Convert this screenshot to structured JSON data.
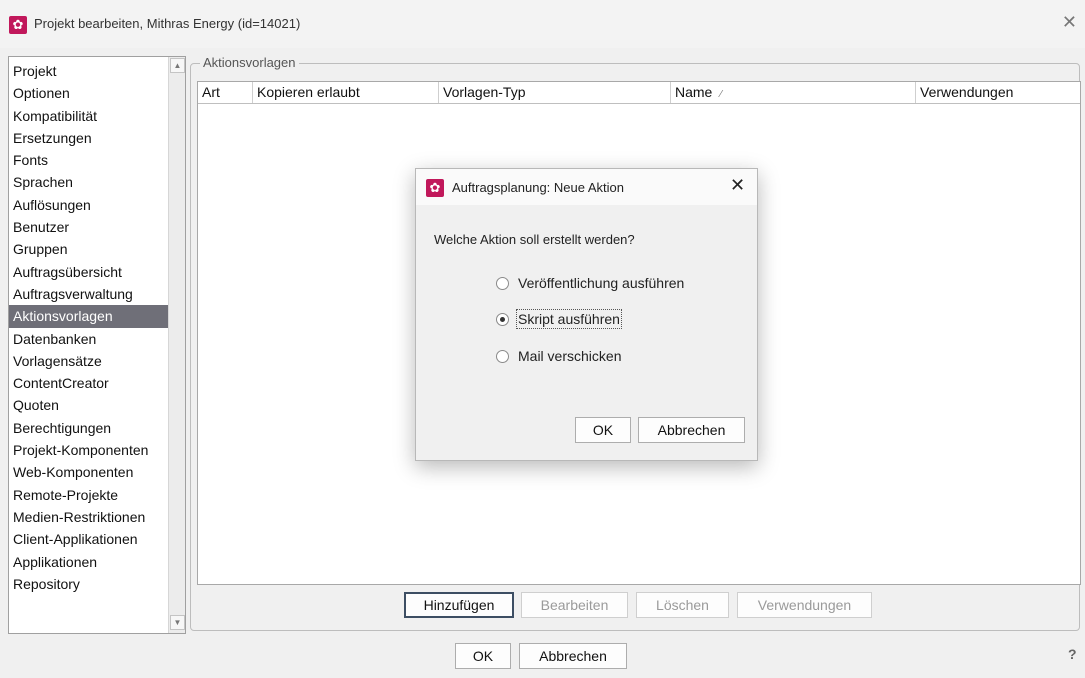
{
  "window": {
    "title": "Projekt bearbeiten, Mithras Energy (id=14021)",
    "app_icon": "gear-logo-icon",
    "accent": "#c1185b"
  },
  "sidebar": {
    "items": [
      "Projekt",
      "Optionen",
      "Kompatibilität",
      "Ersetzungen",
      "Fonts",
      "Sprachen",
      "Auflösungen",
      "Benutzer",
      "Gruppen",
      "Auftragsübersicht",
      "Auftragsverwaltung",
      "Aktionsvorlagen",
      "Datenbanken",
      "Vorlagensätze",
      "ContentCreator",
      "Quoten",
      "Berechtigungen",
      "Projekt-Komponenten",
      "Web-Komponenten",
      "Remote-Projekte",
      "Medien-Restriktionen",
      "Client-Applikationen",
      "Applikationen",
      "Repository"
    ],
    "selected": "Aktionsvorlagen"
  },
  "panel": {
    "legend": "Aktionsvorlagen",
    "columns": [
      "Art",
      "Kopieren erlaubt",
      "Vorlagen-Typ",
      "Name",
      "Verwendungen"
    ],
    "sort_indicator": "⁄",
    "buttons": {
      "add": "Hinzufügen",
      "edit": "Bearbeiten",
      "delete": "Löschen",
      "usages": "Verwendungen"
    }
  },
  "footer": {
    "ok": "OK",
    "cancel": "Abbrechen",
    "help": "?"
  },
  "dialog": {
    "title": "Auftragsplanung: Neue Aktion",
    "question": "Welche Aktion soll erstellt werden?",
    "options": [
      {
        "label": "Veröffentlichung ausführen",
        "checked": false
      },
      {
        "label": "Skript ausführen",
        "checked": true
      },
      {
        "label": "Mail verschicken",
        "checked": false
      }
    ],
    "ok": "OK",
    "cancel": "Abbrechen"
  }
}
